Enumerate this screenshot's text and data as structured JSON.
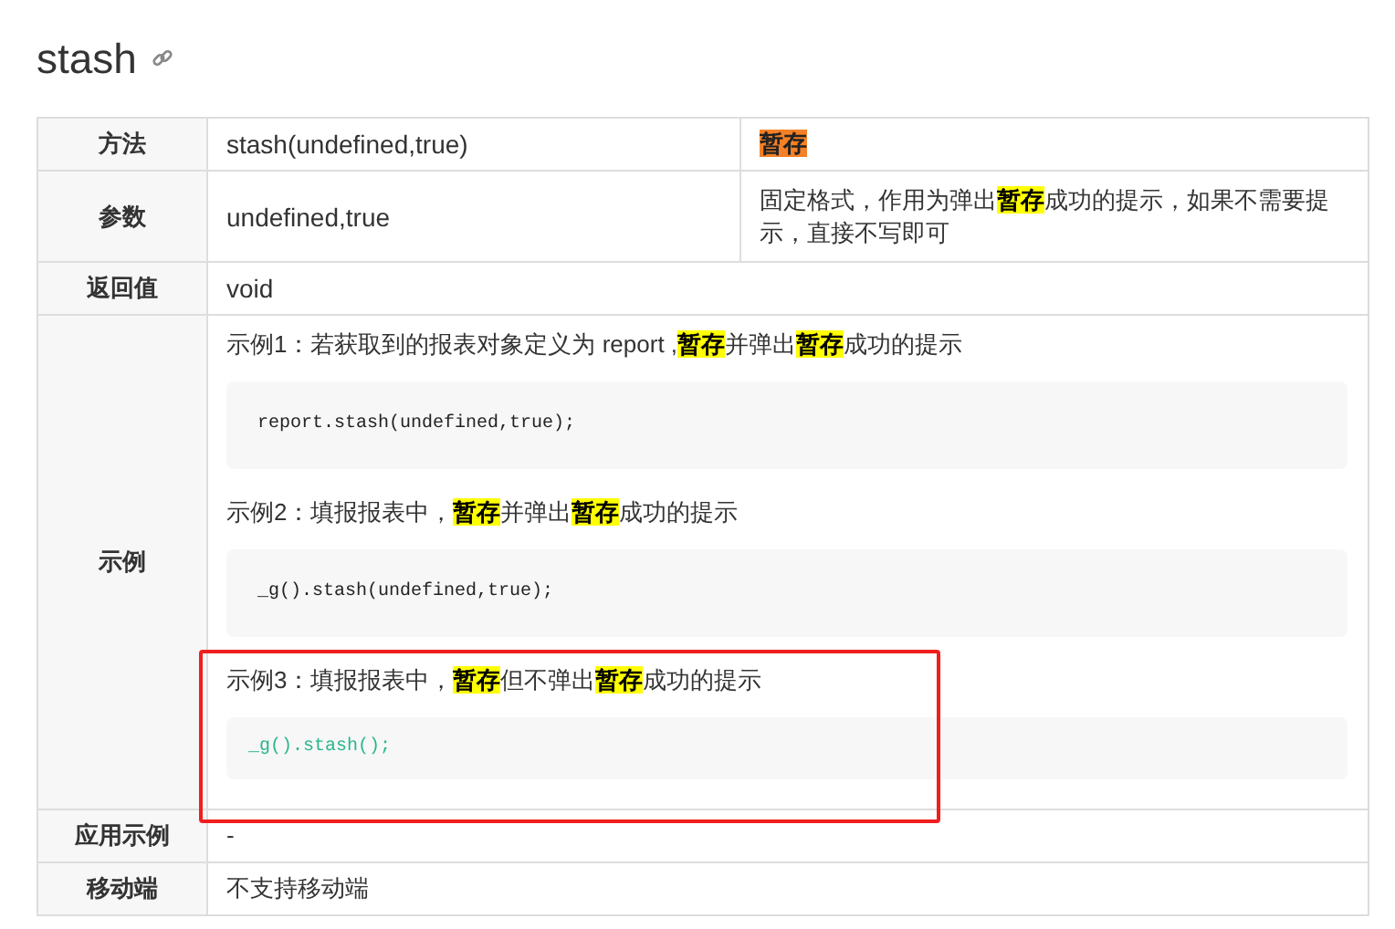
{
  "title": "stash",
  "rows": [
    {
      "kind": "split",
      "label": "方法",
      "cells": [
        {
          "text": "stash(undefined,true)",
          "tag": false
        },
        {
          "text": "暂存",
          "tag": true
        }
      ]
    },
    {
      "kind": "split",
      "label": "参数",
      "cells": [
        {
          "text": "undefined,true",
          "tag": false
        },
        {
          "text": "固定格式，作用为弹出**暂存**成功的提示，如果不需要提示，直接不写即可",
          "tag": false
        }
      ]
    },
    {
      "kind": "text",
      "label": "返回值",
      "text": "void"
    },
    {
      "kind": "examples",
      "label": "示例",
      "examples": [
        {
          "caption": "示例1：若获取到的报表对象定义为 report ,**暂存**并弹出**暂存**成功的提示",
          "code": "report.stash(undefined,true);",
          "framed": false,
          "highlighted": false
        },
        {
          "caption": "示例2：填报报表中，**暂存**并弹出**暂存**成功的提示",
          "code": "_g().stash(undefined,true);",
          "framed": false,
          "highlighted": false
        },
        {
          "caption": "示例3：填报报表中，**暂存**但不弹出**暂存**成功的提示",
          "code": "_g().stash();",
          "framed": true,
          "highlighted": true
        }
      ]
    },
    {
      "kind": "text",
      "label": "应用示例",
      "text": "-"
    },
    {
      "kind": "text",
      "label": "移动端",
      "text": "不支持移动端"
    }
  ]
}
